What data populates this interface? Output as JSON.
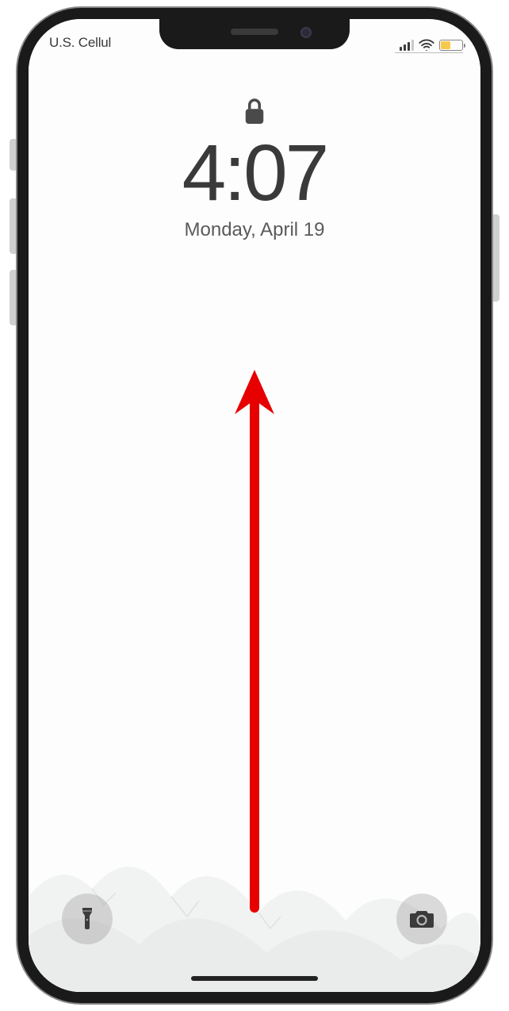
{
  "status_bar": {
    "carrier": "U.S. Cellul",
    "signal_bars_active": 3,
    "signal_bars_total": 4,
    "battery_color": "#f7c94b"
  },
  "lock_screen": {
    "time": "4:07",
    "date": "Monday, April 19"
  },
  "annotation": {
    "arrow_color": "#e60000"
  },
  "icons": {
    "lock": "lock-icon",
    "flashlight": "flashlight-icon",
    "camera": "camera-icon",
    "wifi": "wifi-icon",
    "signal": "signal-icon",
    "battery": "battery-icon"
  }
}
